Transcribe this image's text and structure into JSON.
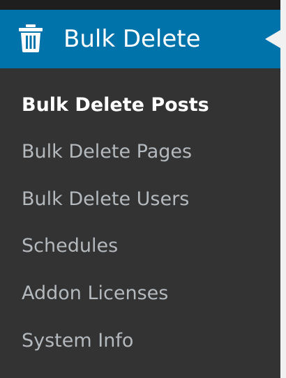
{
  "menu": {
    "title": "Bulk Delete",
    "icon": "trash-icon",
    "colors": {
      "header_bg": "#0073aa",
      "submenu_bg": "#333333",
      "item_text": "#b4b9be",
      "current_text": "#ffffff"
    }
  },
  "submenu": {
    "items": [
      {
        "label": "Bulk Delete Posts",
        "current": true
      },
      {
        "label": "Bulk Delete Pages",
        "current": false
      },
      {
        "label": "Bulk Delete Users",
        "current": false
      },
      {
        "label": "Schedules",
        "current": false
      },
      {
        "label": "Addon Licenses",
        "current": false
      },
      {
        "label": "System Info",
        "current": false
      }
    ]
  }
}
